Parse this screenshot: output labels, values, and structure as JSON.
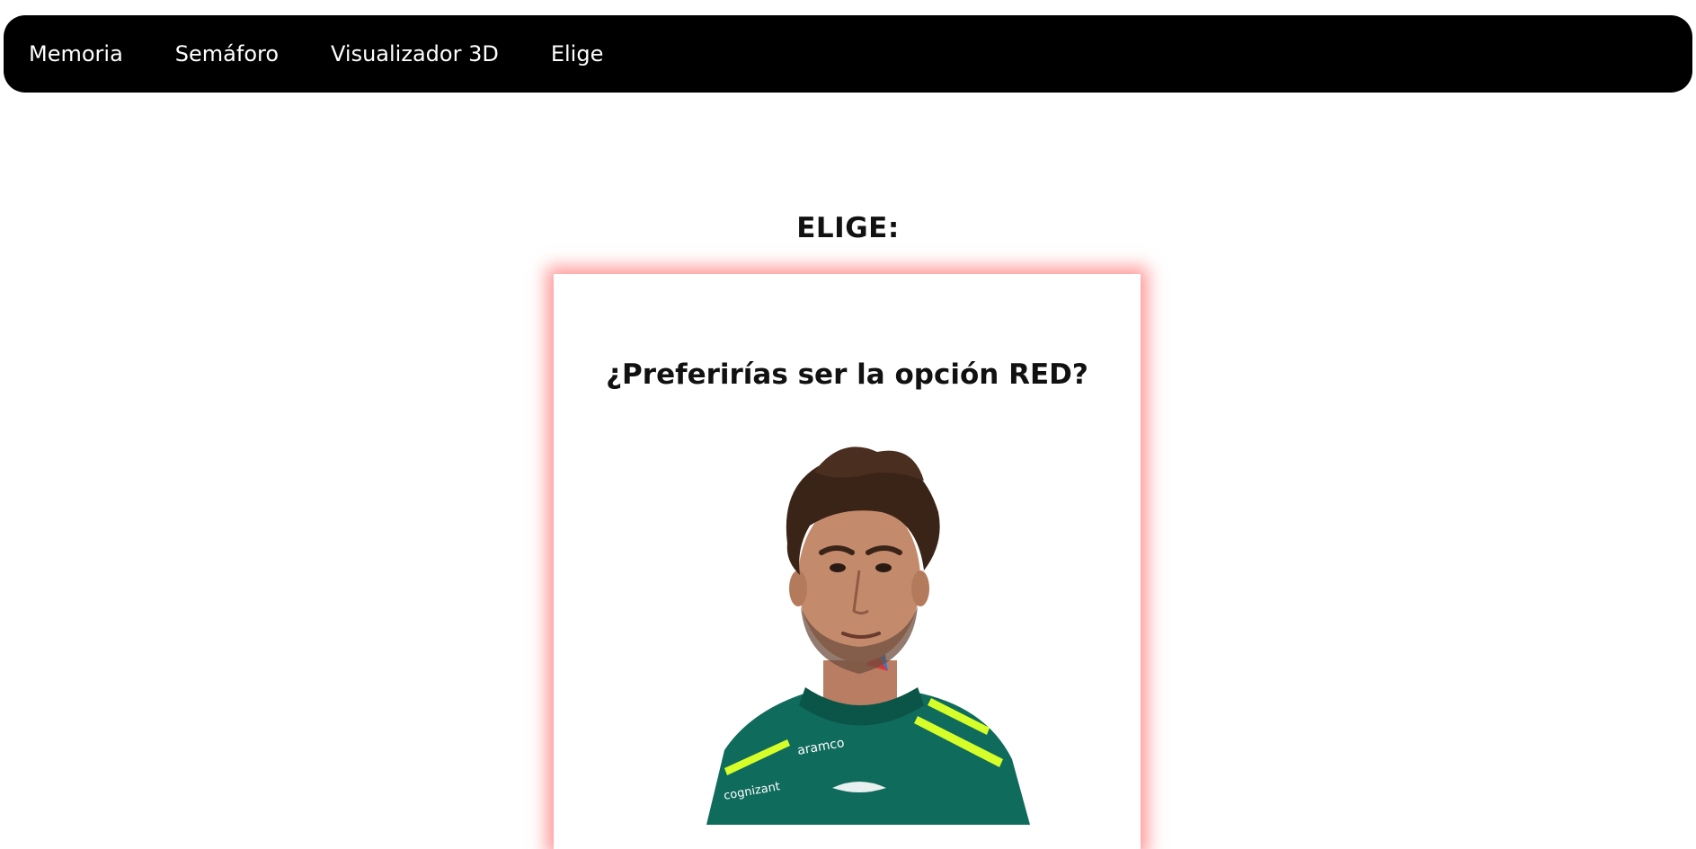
{
  "nav": {
    "items": [
      {
        "label": "Memoria"
      },
      {
        "label": "Semáforo"
      },
      {
        "label": "Visualizador 3D"
      },
      {
        "label": "Elige"
      }
    ]
  },
  "main": {
    "heading": "ELIGE:",
    "card": {
      "question": "¿Preferirías ser la opción RED?",
      "glow_color": "#ff4646",
      "image": {
        "subject": "racing-driver-portrait",
        "suit_color": "#0f6b5c",
        "brand_text_1": "aramco",
        "brand_text_2": "cognizant"
      }
    }
  }
}
